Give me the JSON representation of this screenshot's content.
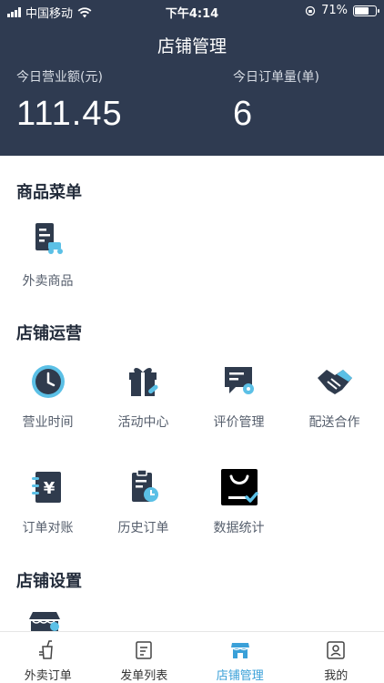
{
  "status": {
    "carrier": "中国移动",
    "time": "下午4:14",
    "battery": "71%",
    "battery_level": 0.71
  },
  "header": {
    "title": "店铺管理"
  },
  "stats": [
    {
      "label": "今日营业额(元)",
      "value": "111.45"
    },
    {
      "label": "今日订单量(单)",
      "value": "6"
    }
  ],
  "sections": {
    "goods": {
      "title": "商品菜单",
      "items": [
        {
          "label": "外卖商品",
          "icon": "takeaway-goods-icon"
        }
      ]
    },
    "operation": {
      "title": "店铺运营",
      "items": [
        {
          "label": "营业时间",
          "icon": "clock-icon"
        },
        {
          "label": "活动中心",
          "icon": "gift-icon"
        },
        {
          "label": "评价管理",
          "icon": "review-icon"
        },
        {
          "label": "配送合作",
          "icon": "handshake-icon"
        },
        {
          "label": "订单对账",
          "icon": "bill-icon"
        },
        {
          "label": "历史订单",
          "icon": "history-order-icon"
        },
        {
          "label": "数据统计",
          "icon": "shopping-bag-icon"
        }
      ]
    },
    "settings": {
      "title": "店铺设置"
    }
  },
  "tabbar": [
    {
      "label": "外卖订单",
      "icon": "takeaway-order-icon",
      "active": false
    },
    {
      "label": "发单列表",
      "icon": "dispatch-list-icon",
      "active": false
    },
    {
      "label": "店铺管理",
      "icon": "store-icon",
      "active": true
    },
    {
      "label": "我的",
      "icon": "profile-icon",
      "active": false
    }
  ],
  "colors": {
    "header_bg": "#2f3b51",
    "icon_dark": "#2f3b4d",
    "accent": "#3aa0d8"
  }
}
